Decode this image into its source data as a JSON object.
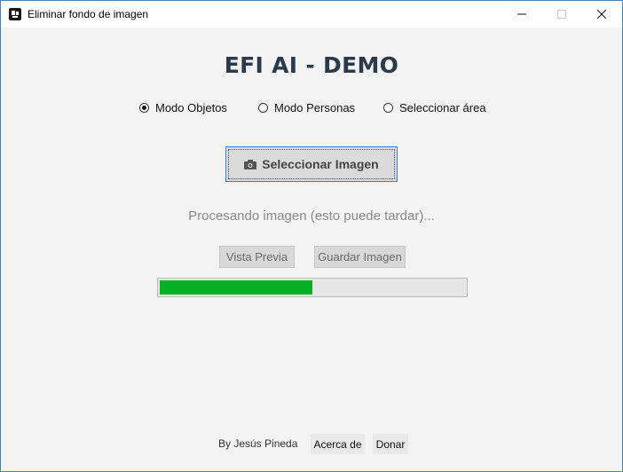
{
  "window": {
    "title": "Eliminar fondo de imagen",
    "icons": {
      "app": "app-icon",
      "minimize": "minimize-icon",
      "maximize": "maximize-icon",
      "close": "close-icon"
    }
  },
  "main": {
    "heading": "EFI AI - DEMO",
    "modes": [
      {
        "label": "Modo Objetos",
        "selected": true
      },
      {
        "label": "Modo Personas",
        "selected": false
      },
      {
        "label": "Seleccionar área",
        "selected": false
      }
    ],
    "select_button": {
      "label": "Seleccionar Imagen",
      "icon": "camera-icon"
    },
    "status": "Procesando imagen (esto puede tardar)...",
    "preview_button": {
      "label": "Vista Previa",
      "enabled": false
    },
    "save_button": {
      "label": "Guardar Imagen",
      "enabled": false
    },
    "progress": {
      "fraction": 0.5,
      "color": "#06b025"
    }
  },
  "footer": {
    "credit": "By Jesús Pineda",
    "about_label": "Acerca de",
    "donate_label": "Donar"
  },
  "colors": {
    "heading": "#2b3a4a",
    "status_text": "#8a8a8a",
    "focus_border": "#3c7fd6",
    "window_border": "#4a7ebb"
  }
}
